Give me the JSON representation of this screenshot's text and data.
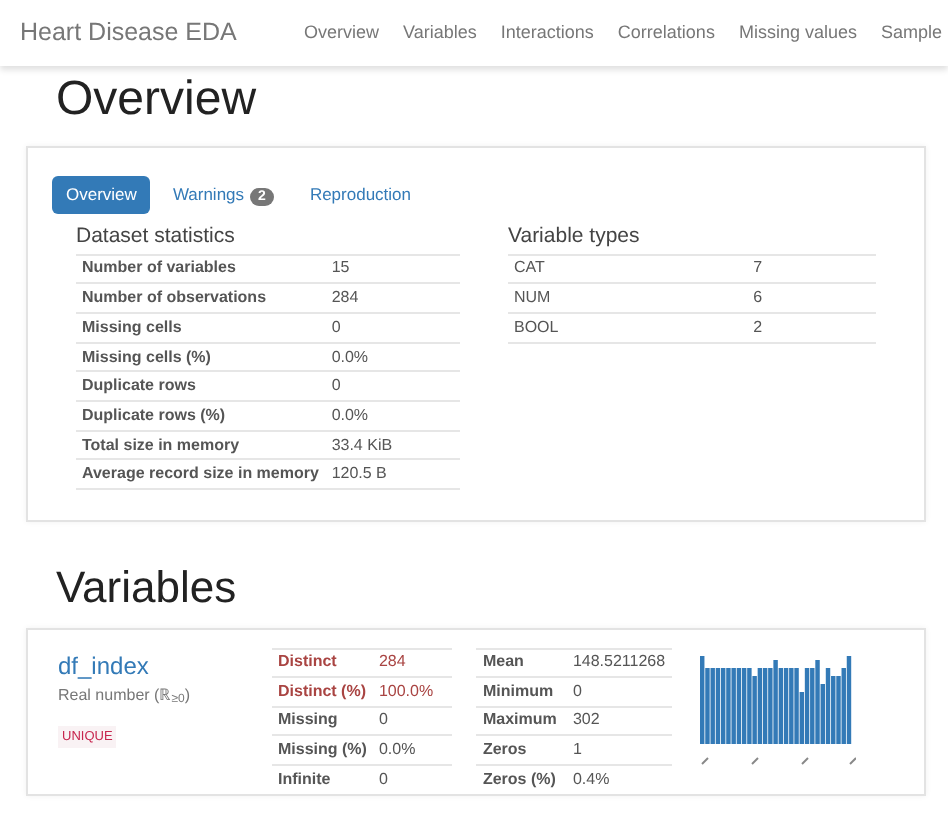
{
  "navbar": {
    "brand": "Heart Disease EDA",
    "links": [
      "Overview",
      "Variables",
      "Interactions",
      "Correlations",
      "Missing values",
      "Sample"
    ]
  },
  "overview": {
    "heading": "Overview",
    "tabs": [
      {
        "label": "Overview",
        "selected": true
      },
      {
        "label": "Warnings",
        "badge": "2",
        "selected": false
      },
      {
        "label": "Reproduction",
        "selected": false
      }
    ],
    "dataset_statistics": {
      "title": "Dataset statistics",
      "rows": [
        [
          "Number of variables",
          "15"
        ],
        [
          "Number of observations",
          "284"
        ],
        [
          "Missing cells",
          "0"
        ],
        [
          "Missing cells (%)",
          "0.0%"
        ],
        [
          "Duplicate rows",
          "0"
        ],
        [
          "Duplicate rows (%)",
          "0.0%"
        ],
        [
          "Total size in memory",
          "33.4 KiB"
        ],
        [
          "Average record size in memory",
          "120.5 B"
        ]
      ]
    },
    "variable_types": {
      "title": "Variable types",
      "rows": [
        [
          "CAT",
          "7"
        ],
        [
          "NUM",
          "6"
        ],
        [
          "BOOL",
          "2"
        ]
      ]
    }
  },
  "variables": {
    "heading": "Variables",
    "items": [
      {
        "name": "df_index",
        "type": "Real number (ℝ$_{≥0}$)",
        "tag": "UNIQUE",
        "stats_left": [
          {
            "label": "Distinct",
            "value": "284",
            "alert": true
          },
          {
            "label": "Distinct (%)",
            "value": "100.0%",
            "alert": true
          },
          {
            "label": "Missing",
            "value": "0",
            "alert": false
          },
          {
            "label": "Missing (%)",
            "value": "0.0%",
            "alert": false
          },
          {
            "label": "Infinite",
            "value": "0",
            "alert": false
          }
        ],
        "stats_right": [
          {
            "label": "Mean",
            "value": "148.5211268"
          },
          {
            "label": "Minimum",
            "value": "0"
          },
          {
            "label": "Maximum",
            "value": "302"
          },
          {
            "label": "Zeros",
            "value": "1"
          },
          {
            "label": "Zeros (%)",
            "value": "0.4%"
          }
        ]
      }
    ]
  }
}
